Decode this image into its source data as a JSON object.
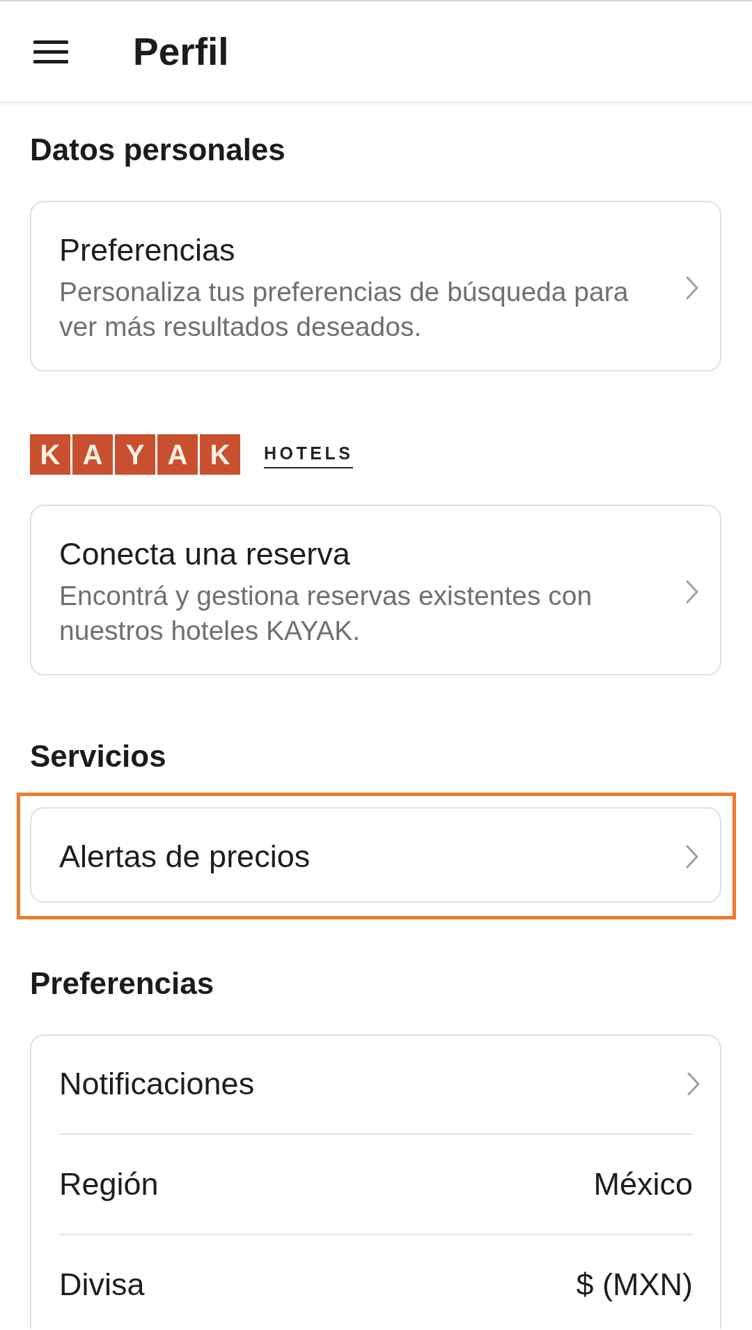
{
  "header": {
    "title": "Perfil"
  },
  "sections": [
    {
      "kind": "group",
      "heading": "Datos personales",
      "items": [
        {
          "title": "Preferencias",
          "description": "Personaliza tus preferencias de búsqueda para ver más resultados deseados.",
          "highlighted": false
        }
      ]
    },
    {
      "kind": "brand",
      "logo": {
        "letters": [
          "K",
          "A",
          "Y",
          "A",
          "K"
        ],
        "label": "HOTELS"
      },
      "items": [
        {
          "title": "Conecta una reserva",
          "description": "Encontrá y gestiona reservas existentes con nuestros hoteles KAYAK.",
          "highlighted": false
        }
      ]
    },
    {
      "kind": "group",
      "heading": "Servicios",
      "items": [
        {
          "title": "Alertas de precios",
          "highlighted": true
        }
      ]
    },
    {
      "kind": "list",
      "heading": "Preferencias",
      "rows": [
        {
          "kind": "link",
          "label": "Notificaciones"
        },
        {
          "kind": "value",
          "label": "Región",
          "value": "México"
        },
        {
          "kind": "value",
          "label": "Divisa",
          "value": "$ (MXN)"
        }
      ]
    }
  ]
}
